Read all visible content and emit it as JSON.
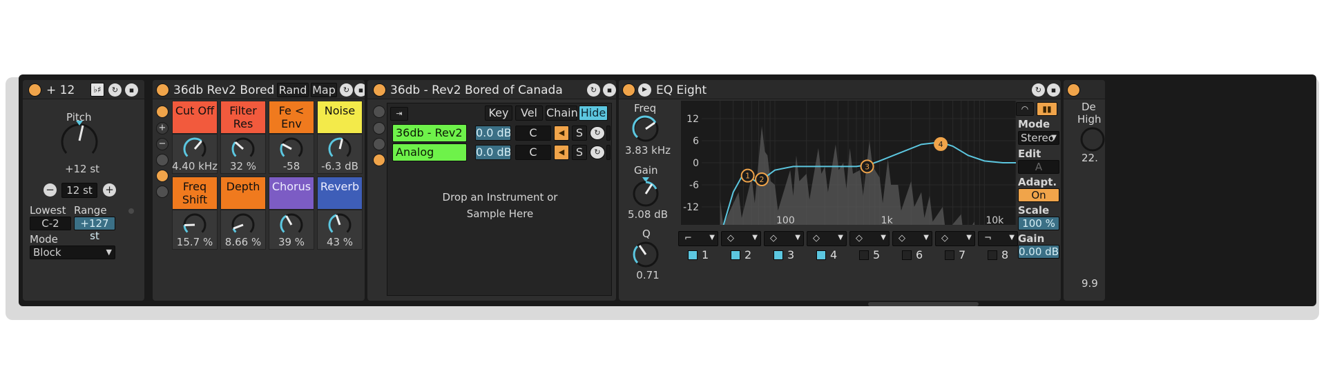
{
  "pitch": {
    "title": "+ 12",
    "scale_label": "♭♯",
    "knob_label": "Pitch",
    "knob_value": "+12 st",
    "step_value": "12 st",
    "lowest_label": "Lowest",
    "range_label": "Range",
    "lowest_value": "C-2",
    "range_value": "+127 st",
    "mode_label": "Mode",
    "mode_value": "Block"
  },
  "rack": {
    "title": "36db Rev2 Bored of ...",
    "rand_label": "Rand",
    "map_label": "Map",
    "macros": [
      {
        "name": "Cut Off",
        "value": "4.40 kHz",
        "color": "#f25a3d",
        "level": 0.65
      },
      {
        "name": "Filter\nRes",
        "value": "32 %",
        "color": "#f25a3d",
        "level": 0.32
      },
      {
        "name": "Fe < Env",
        "value": "-58",
        "color": "#f07a1e",
        "level": 0.27
      },
      {
        "name": "Noise",
        "value": "-6.3 dB",
        "color": "#f3ea4a",
        "level": 0.55
      },
      {
        "name": "Freq\nShift",
        "value": "15.7 %",
        "color": "#f07a1e",
        "level": 0.16
      },
      {
        "name": "Depth",
        "value": "8.66 %",
        "color": "#f07a1e",
        "level": 0.09
      },
      {
        "name": "Chorus",
        "value": "39 %",
        "color": "#7c5cc4",
        "level": 0.39
      },
      {
        "name": "Reverb",
        "value": "43 %",
        "color": "#3e5eb8",
        "level": 0.43
      }
    ]
  },
  "chains": {
    "title": "36db - Rev2 Bored of Canada",
    "key_label": "Key",
    "vel_label": "Vel",
    "chain_label": "Chain",
    "hide_label": "Hide",
    "rows": [
      {
        "name": "36db - Rev2 ...",
        "volume": "0.0 dB",
        "pan": "C",
        "solo": "S"
      },
      {
        "name": "Analog",
        "volume": "0.0 dB",
        "pan": "C",
        "solo": "S"
      }
    ],
    "drop_hint": "Drop an Instrument or Sample Here"
  },
  "eq": {
    "title": "EQ Eight",
    "freq_label": "Freq",
    "freq_value": "3.83 kHz",
    "gain_label": "Gain",
    "gain_value": "5.08 dB",
    "q_label": "Q",
    "q_value": "0.71",
    "y_ticks": [
      "12",
      "6",
      "0",
      "-6",
      "-12"
    ],
    "x_ticks": [
      "100",
      "1k",
      "10k"
    ],
    "nodes": [
      "1",
      "2",
      "3",
      "4"
    ],
    "bands": [
      {
        "number": "1",
        "active": true
      },
      {
        "number": "2",
        "active": true
      },
      {
        "number": "3",
        "active": true
      },
      {
        "number": "4",
        "active": true
      },
      {
        "number": "5",
        "active": false
      },
      {
        "number": "6",
        "active": false
      },
      {
        "number": "7",
        "active": false
      },
      {
        "number": "8",
        "active": false
      }
    ],
    "mode_label": "Mode",
    "mode_value": "Stereo",
    "edit_label": "Edit",
    "edit_value": "A",
    "adaptq_label": "Adapt. Q",
    "adaptq_value": "On",
    "scale_label": "Scale",
    "scale_value": "100 %",
    "outgain_label": "Gain",
    "outgain_value": "0.00 dB",
    "accent": "#5cc7e0",
    "node_color": "#f0a44a"
  },
  "partial": {
    "label1": "De",
    "label2": "High",
    "value1": "22.",
    "value2": "9.9"
  }
}
